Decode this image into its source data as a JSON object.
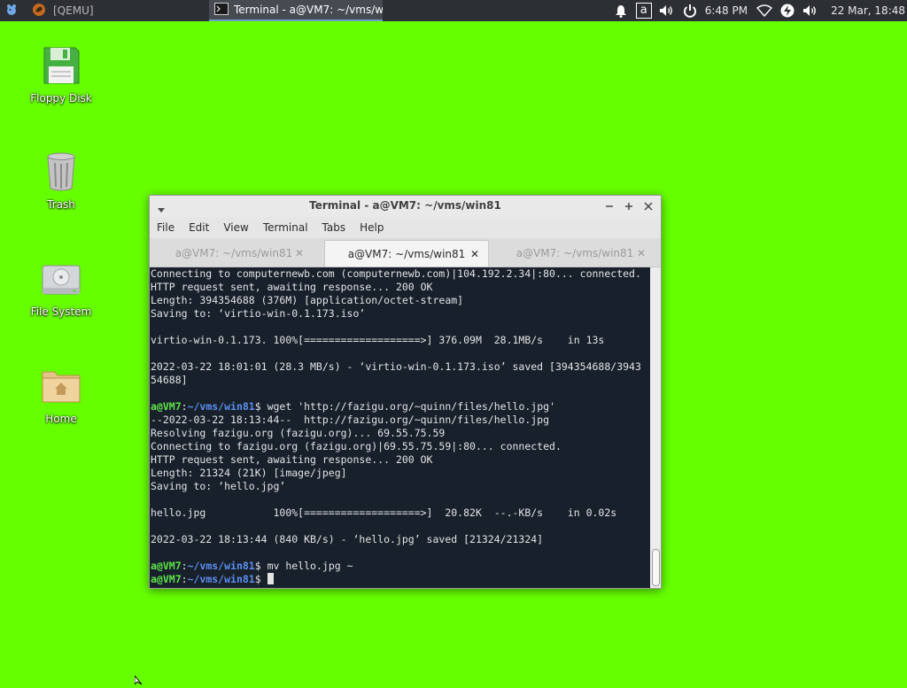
{
  "panel": {
    "qemu_task": "[QEMU]",
    "terminal_task": "Terminal - a@VM7: ~/vms/w...",
    "keyboard_layout": "a",
    "time": "6:48 PM",
    "date": "22 Mar, 18:48"
  },
  "desktop": {
    "icons": [
      {
        "label": "Floppy Disk",
        "icon": "floppy-disk-icon"
      },
      {
        "label": "Trash",
        "icon": "trash-icon"
      },
      {
        "label": "File System",
        "icon": "hard-drive-icon"
      },
      {
        "label": "Home",
        "icon": "home-folder-icon"
      }
    ]
  },
  "window": {
    "title": "Terminal - a@VM7: ~/vms/win81",
    "menu": [
      "File",
      "Edit",
      "View",
      "Terminal",
      "Tabs",
      "Help"
    ],
    "tabs": [
      {
        "label": "a@VM7: ~/vms/win81",
        "active": false
      },
      {
        "label": "a@VM7: ~/vms/win81",
        "active": true
      },
      {
        "label": "a@VM7: ~/vms/win81",
        "active": false
      }
    ]
  },
  "terminal": {
    "prompt_user": "a@VM7",
    "prompt_path": "~/vms/win81",
    "lines": [
      "Connecting to computernewb.com (computernewb.com)|104.192.2.34|:80... connected.",
      "HTTP request sent, awaiting response... 200 OK",
      "Length: 394354688 (376M) [application/octet-stream]",
      "Saving to: ‘virtio-win-0.1.173.iso’",
      "",
      "virtio-win-0.1.173. 100%[===================>] 376.09M  28.1MB/s    in 13s",
      "",
      "2022-03-22 18:01:01 (28.3 MB/s) - ‘virtio-win-0.1.173.iso’ saved [394354688/3943",
      "54688]",
      "",
      "$ wget 'http://fazigu.org/~quinn/files/hello.jpg'",
      "--2022-03-22 18:13:44--  http://fazigu.org/~quinn/files/hello.jpg",
      "Resolving fazigu.org (fazigu.org)... 69.55.75.59",
      "Connecting to fazigu.org (fazigu.org)|69.55.75.59|:80... connected.",
      "HTTP request sent, awaiting response... 200 OK",
      "Length: 21324 (21K) [image/jpeg]",
      "Saving to: ‘hello.jpg’",
      "",
      "hello.jpg           100%[===================>]  20.82K  --.-KB/s    in 0.02s",
      "",
      "2022-03-22 18:13:44 (840 KB/s) - ‘hello.jpg’ saved [21324/21324]",
      "",
      "$ mv hello.jpg ~",
      "$ "
    ],
    "prompt_line_indexes": [
      10,
      22,
      23
    ]
  }
}
